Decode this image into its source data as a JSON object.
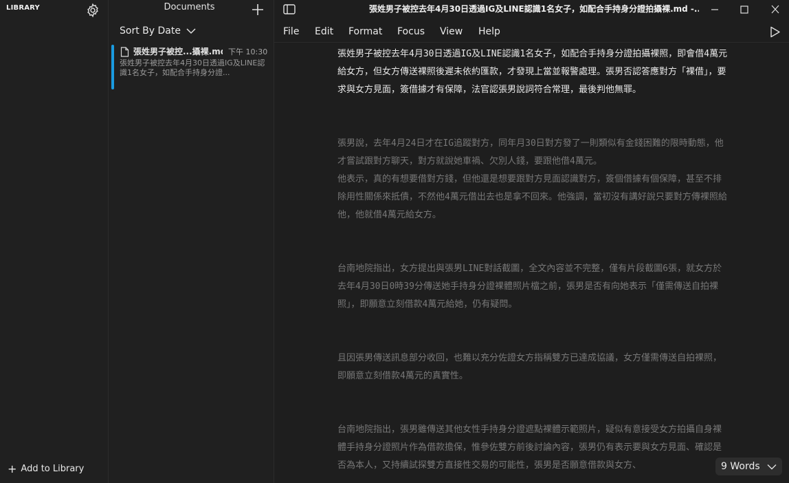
{
  "library": {
    "title": "LIBRARY",
    "add_label": "Add to Library"
  },
  "documents": {
    "title": "Documents",
    "sort_label": "Sort By Date",
    "items": [
      {
        "name": "張姓男子被控...攝裸.md",
        "time": "下午 10:30",
        "preview": "張姓男子被控去年4月30日透過IG及LINE認識1名女子，如配合手持身分證..."
      }
    ]
  },
  "window": {
    "title": "張姓男子被控去年4月30日透過IG及LINE認識1名女子，如配合手持身分證拍攝裸.md -..."
  },
  "menu": {
    "file": "File",
    "edit": "Edit",
    "format": "Format",
    "focus": "Focus",
    "view": "View",
    "help": "Help"
  },
  "editor": {
    "paragraphs": [
      "張姓男子被控去年4月30日透過IG及LINE認識1名女子，如配合手持身分證拍攝裸照，即會借4萬元給女方，但女方傳送裸照後遲未依約匯款，才發現上當並報警處理。張男否認答應對方「裸借」，要求與女方見面，簽借據才有保障，法官認張男說詞符合常理，最後判他無罪。",
      "張男說，去年4月24日才在IG追蹤對方，同年月30日對方發了一則類似有金錢困難的限時動態，他才嘗試跟對方聊天，對方就說她車禍、欠別人錢，要跟他借4萬元。\n他表示，真的有想要借對方錢，但他還是想要跟對方見面認識對方，簽個借據有個保障，甚至不排除用性關係來抵債，不然他4萬元借出去也是拿不回來。他強調，當初沒有講好說只要對方傳裸照給他，他就借4萬元給女方。",
      "台南地院指出，女方提出與張男LINE對話截圖，全文內容並不完整，僅有片段截圖6張，就女方於去年4月30日0時39分傳送她手持身分證裸體照片檔之前，張男是否有向她表示「僅需傳送自拍裸照」，即願意立刻借款4萬元給她，仍有疑問。",
      "且因張男傳送訊息部分收回，也難以充分佐證女方指稱雙方已達成協議，女方僅需傳送自拍裸照，即願意立刻借款4萬元的真實性。",
      "台南地院指出，張男雖傳送其他女性手持身分證遮點裸體示範照片，疑似有意接受女方拍攝自身裸體手持身分證照片作為借款擔保，惟參佐雙方前後討論內容，張男仍有表示要與女方見面、確認是否為本人，又持續試探雙方直接性交易的可能性，張男是否願意借款與女方、"
    ]
  },
  "status": {
    "word_count": "9 Words"
  }
}
